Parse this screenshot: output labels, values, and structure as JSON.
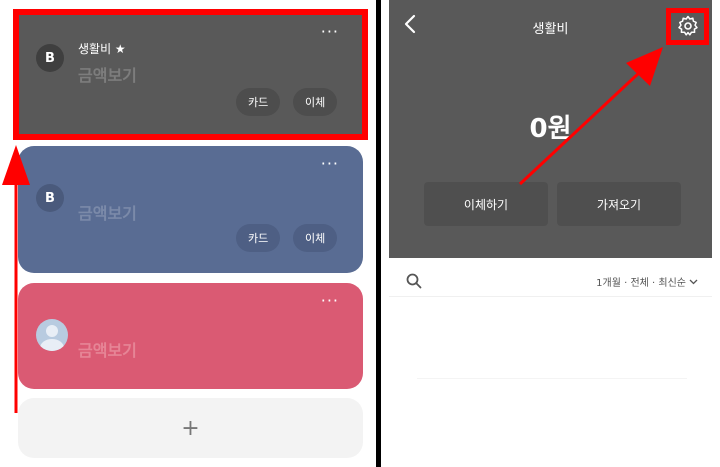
{
  "left": {
    "cards": [
      {
        "name": "생활비 ★",
        "amount": "금액보기",
        "more": "···",
        "avatar_letter": "B",
        "buttons": {
          "card": "카드",
          "transfer": "이체"
        }
      },
      {
        "amount": "금액보기",
        "more": "···",
        "avatar_letter": "B",
        "buttons": {
          "card": "카드",
          "transfer": "이체"
        }
      },
      {
        "amount": "금액보기",
        "more": "···",
        "avatar": "person-avatar-icon"
      }
    ],
    "add_symbol": "+"
  },
  "right": {
    "back_symbol": "<",
    "title": "생활비",
    "balance": "0원",
    "actions": {
      "transfer": "이체하기",
      "fetch": "가져오기"
    },
    "filter": "1개월 · 전체 · 최신순",
    "icons": {
      "back": "back-arrow-icon",
      "settings": "gear-icon",
      "search": "search-icon",
      "filter_toggle": "chevron-down-icon"
    }
  },
  "colors": {
    "annotation": "#ff0000",
    "card_gray": "#595959",
    "card_blue": "#596c93",
    "card_pink": "#da5a73"
  }
}
